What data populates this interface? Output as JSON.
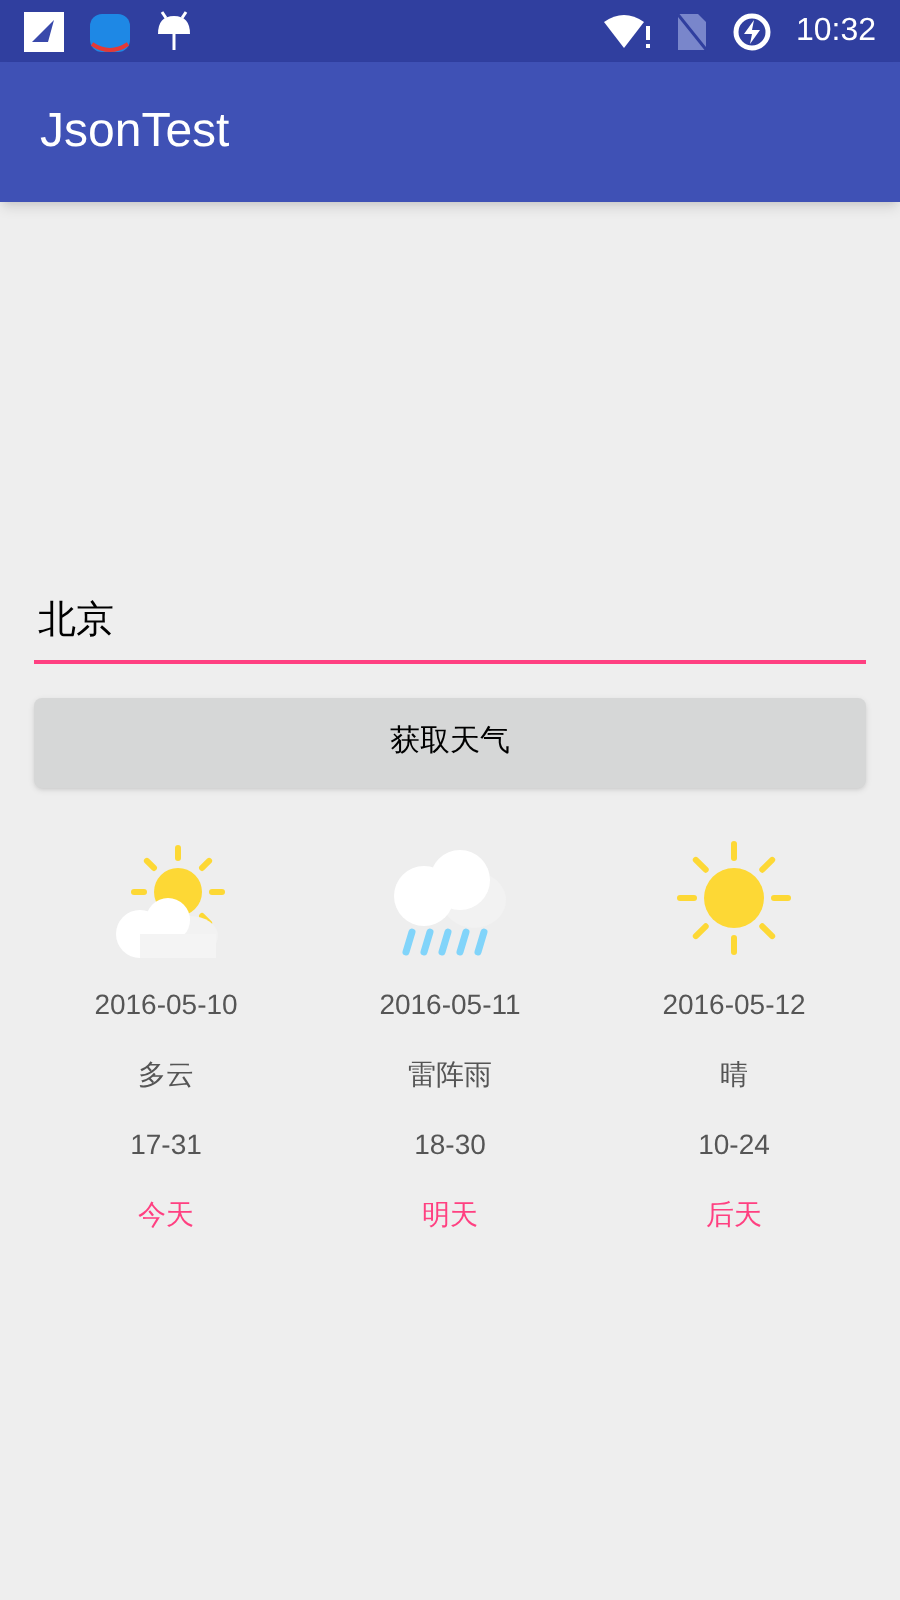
{
  "status_bar": {
    "time": "10:32"
  },
  "app_bar": {
    "title": "JsonTest"
  },
  "city_field": {
    "value": "北京"
  },
  "fetch_button": {
    "label": "获取天气"
  },
  "forecast": [
    {
      "kind": "cloudy",
      "date": "2016-05-10",
      "weather": "多云",
      "temperature": "17-31",
      "day": "今天"
    },
    {
      "kind": "rain",
      "date": "2016-05-11",
      "weather": "雷阵雨",
      "temperature": "18-30",
      "day": "明天"
    },
    {
      "kind": "sunny",
      "date": "2016-05-12",
      "weather": "晴",
      "temperature": "10-24",
      "day": "后天"
    }
  ]
}
